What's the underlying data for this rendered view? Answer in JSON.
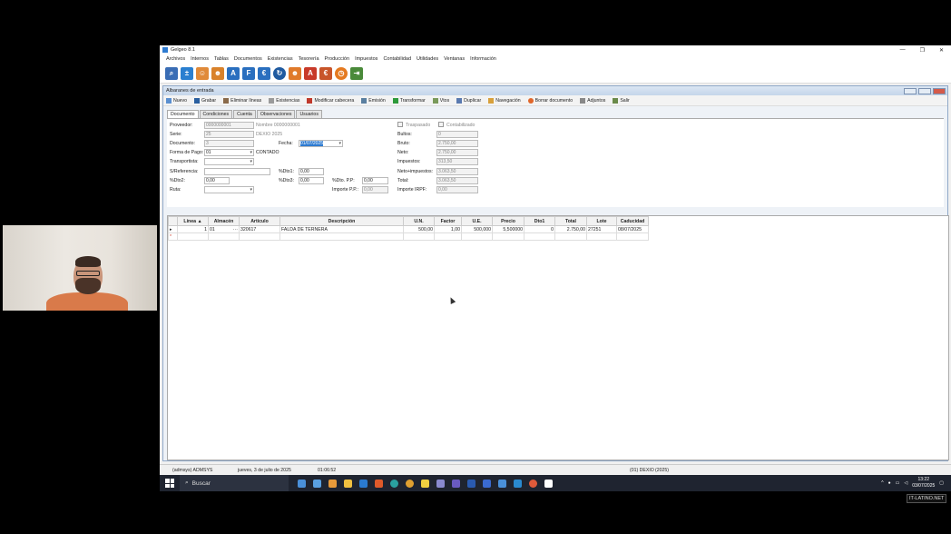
{
  "app": {
    "title": "Gelgeo 8.1"
  },
  "menu": [
    "Archivos",
    "Internos",
    "Tablas",
    "Documentos",
    "Existencias",
    "Tesorería",
    "Producción",
    "Impuestos",
    "Contabilidad",
    "Utilidades",
    "Ventanas",
    "Información"
  ],
  "child_window": {
    "title": "Albaranes de entrada"
  },
  "toolbar": [
    "Nuevo",
    "Grabar",
    "Eliminar líneas",
    "Existencias",
    "Modificar cabecera",
    "Emisión",
    "Transformar",
    "Vtos",
    "Duplicar",
    "Navegación",
    "Borrar documento",
    "Adjuntos",
    "Salir"
  ],
  "tabs": [
    "Documento",
    "Condiciones",
    "Cuenta",
    "Observaciones",
    "Usuarios"
  ],
  "form": {
    "proveedor_label": "Proveedor:",
    "proveedor": "0000000001",
    "nombre": "Nombre 0000000001",
    "serie_label": "Serie:",
    "serie": "25",
    "serie_desc": "DEXIO 2025",
    "documento_label": "Documento:",
    "documento": "3",
    "fecha_label": "Fecha:",
    "fecha": "01/07/2025",
    "forma_pago_label": "Forma de Pago:",
    "forma_pago": "01",
    "forma_pago_desc": "CONTADO",
    "transportista_label": "Transportista:",
    "sreferencia_label": "S/Referencia:",
    "dto1_label": "%Dto1:",
    "dto1": "0,00",
    "dto2_label": "%Dto2:",
    "dto2": "0,00",
    "dto3_label": "%Dto3:",
    "dto3": "0,00",
    "dtopp_label": "%Dto. P.P:",
    "dtopp": "0,00",
    "ruta_label": "Ruta:",
    "importe_pp_label": "Importe P.P.:",
    "importe_pp": "0,00",
    "traspasado_label": "Traspasado",
    "contabilizado_label": "Contabilizado",
    "bultos_label": "Bultos:",
    "bultos": "0",
    "bruto_label": "Bruto:",
    "bruto": "2.750,00",
    "neto_label": "Neto:",
    "neto": "2.750,00",
    "impuestos_label": "Impuestos:",
    "impuestos": "313,50",
    "neto_imp_label": "Neto+impuestos:",
    "neto_imp": "3.063,50",
    "total_label": "Total:",
    "total": "3.063,50",
    "irpf_label": "Importe IRPF:",
    "irpf": "0,00"
  },
  "grid": {
    "columns": [
      "Línea",
      "Almacén",
      "Artículo",
      "Descripción",
      "U.N.",
      "Factor",
      "U.E.",
      "Precio",
      "Dto1",
      "Total",
      "Lote",
      "Caducidad"
    ],
    "rows": [
      [
        "1",
        "01",
        "320617",
        "FALDA DE TERNERA",
        "500,00",
        "1,00",
        "500,000",
        "5,500000",
        "0",
        "2.750,00",
        "27251",
        "08/07/2025"
      ]
    ]
  },
  "statusbar": {
    "user": "(admsys) ADMSYS",
    "date": "jueves, 3 de julio de 2025",
    "time": "01:06:52",
    "company": "(01) DEXIO",
    "year": "(2025)"
  },
  "taskbar": {
    "search_placeholder": "Buscar",
    "clock_time": "13:22",
    "clock_date": "03/07/2025"
  },
  "watermark": "IT-LATINO.NET",
  "colors": {
    "accent": "#2e7bd1",
    "child_title": "#c4d5ea",
    "taskbar": "#1f2430"
  }
}
